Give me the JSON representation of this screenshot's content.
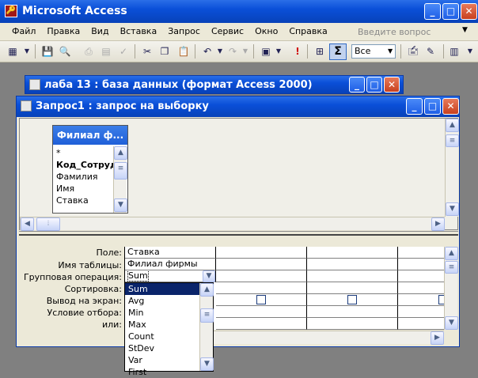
{
  "app": {
    "title": "Microsoft Access",
    "help_placeholder": "Введите вопрос"
  },
  "menu": [
    "Файл",
    "Правка",
    "Вид",
    "Вставка",
    "Запрос",
    "Сервис",
    "Окно",
    "Справка"
  ],
  "toolbar": {
    "totals_symbol": "Σ",
    "top_values": "Все"
  },
  "db_window": {
    "title": "лаба 13 : база данных (формат Access 2000)"
  },
  "query_window": {
    "title": "Запрос1 : запрос на выборку"
  },
  "table_box": {
    "title": "Филиал ф...",
    "fields": [
      "*",
      "Код_Сотрудн",
      "Фамилия",
      "Имя",
      "Ставка"
    ]
  },
  "grid": {
    "row_labels": [
      "Поле:",
      "Имя таблицы:",
      "Групповая операция:",
      "Сортировка:",
      "Вывод на экран:",
      "Условие отбора:",
      "или:"
    ],
    "column1": {
      "field": "Ставка",
      "table": "Филиал фирмы",
      "group_op": "Sum"
    }
  },
  "dropdown": {
    "selected": "Sum",
    "options": [
      "Sum",
      "Avg",
      "Min",
      "Max",
      "Count",
      "StDev",
      "Var",
      "First"
    ]
  }
}
